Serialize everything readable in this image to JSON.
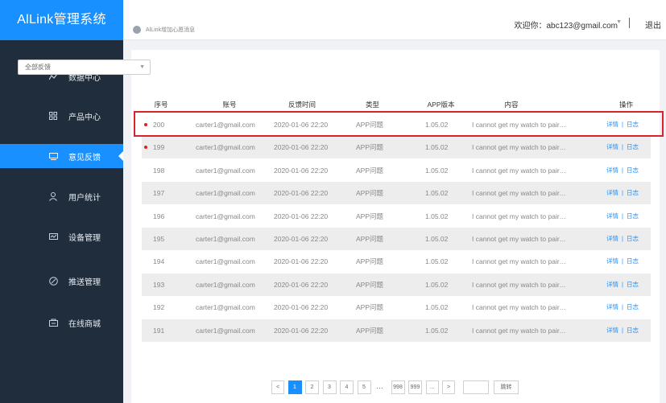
{
  "app": {
    "title": "AlLink管理系统"
  },
  "sidebar": {
    "items": [
      {
        "label": "数据中心",
        "icon": "chart-icon",
        "active": false
      },
      {
        "label": "产品中心",
        "icon": "grid-icon",
        "active": false
      },
      {
        "label": "意见反馈",
        "icon": "feedback-icon",
        "active": true
      },
      {
        "label": "用户统计",
        "icon": "user-icon",
        "active": false
      },
      {
        "label": "设备管理",
        "icon": "device-icon",
        "active": false
      },
      {
        "label": "推送管理",
        "icon": "push-icon",
        "active": false
      },
      {
        "label": "在线商城",
        "icon": "store-icon",
        "active": false
      }
    ]
  },
  "header": {
    "breadcrumb": "AlLink增加心愿消息",
    "welcome": "欢迎你：abc123@gmail.com",
    "logout": "退出"
  },
  "filter": {
    "selected": "全部反馈"
  },
  "table": {
    "columns": [
      "序号",
      "账号",
      "反馈时间",
      "类型",
      "APP版本",
      "内容",
      "操作"
    ],
    "actions": {
      "detail": "详情",
      "log": "日志",
      "separator": "|"
    },
    "rows": [
      {
        "id": "200",
        "account": "carter1@gmail.com",
        "time": "2020-01-06 22:20",
        "type": "APP问题",
        "version": "1.05.02",
        "content": "I cannot get my watch to pair…",
        "unread": true
      },
      {
        "id": "199",
        "account": "carter1@gmail.com",
        "time": "2020-01-06 22:20",
        "type": "APP问题",
        "version": "1.05.02",
        "content": "I cannot get my watch to pair…",
        "unread": true
      },
      {
        "id": "198",
        "account": "carter1@gmail.com",
        "time": "2020-01-06 22:20",
        "type": "APP问题",
        "version": "1.05.02",
        "content": "I cannot get my watch to pair…",
        "unread": false
      },
      {
        "id": "197",
        "account": "carter1@gmail.com",
        "time": "2020-01-06 22:20",
        "type": "APP问题",
        "version": "1.05.02",
        "content": "I cannot get my watch to pair…",
        "unread": false
      },
      {
        "id": "196",
        "account": "carter1@gmail.com",
        "time": "2020-01-06 22:20",
        "type": "APP问题",
        "version": "1.05.02",
        "content": "I cannot get my watch to pair…",
        "unread": false
      },
      {
        "id": "195",
        "account": "carter1@gmail.com",
        "time": "2020-01-06 22:20",
        "type": "APP问题",
        "version": "1.05.02",
        "content": "I cannot get my watch to pair…",
        "unread": false
      },
      {
        "id": "194",
        "account": "carter1@gmail.com",
        "time": "2020-01-06 22:20",
        "type": "APP问题",
        "version": "1.05.02",
        "content": "I cannot get my watch to pair…",
        "unread": false
      },
      {
        "id": "193",
        "account": "carter1@gmail.com",
        "time": "2020-01-06 22:20",
        "type": "APP问题",
        "version": "1.05.02",
        "content": "I cannot get my watch to pair…",
        "unread": false
      },
      {
        "id": "192",
        "account": "carter1@gmail.com",
        "time": "2020-01-06 22:20",
        "type": "APP问题",
        "version": "1.05.02",
        "content": "I cannot get my watch to pair…",
        "unread": false
      },
      {
        "id": "191",
        "account": "carter1@gmail.com",
        "time": "2020-01-06 22:20",
        "type": "APP问题",
        "version": "1.05.02",
        "content": "I cannot get my watch to pair…",
        "unread": false
      }
    ]
  },
  "pagination": {
    "prev": "<",
    "next": ">",
    "pages": [
      "1",
      "2",
      "3",
      "4",
      "5",
      "…",
      "998",
      "999",
      "…"
    ],
    "current": "1",
    "go": "跳转"
  },
  "colors": {
    "brand": "#1890ff",
    "sidebar": "#1f2d3d",
    "unread_dot": "#e02020",
    "highlight": "#d9232a"
  }
}
